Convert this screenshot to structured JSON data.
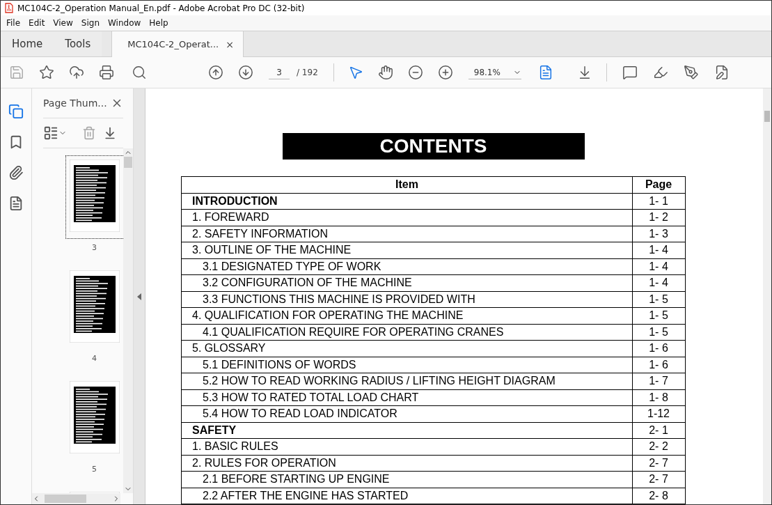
{
  "window": {
    "title": "MC104C-2_Operation Manual_En.pdf - Adobe Acrobat Pro DC (32-bit)"
  },
  "menu": [
    "File",
    "Edit",
    "View",
    "Sign",
    "Window",
    "Help"
  ],
  "tabs": [
    {
      "label": "Home",
      "selected": false,
      "kind": "nav"
    },
    {
      "label": "Tools",
      "selected": false,
      "kind": "nav"
    },
    {
      "label": "MC104C-2_Operat...",
      "selected": true,
      "kind": "document",
      "close": "×"
    }
  ],
  "toolbar": {
    "page_number": "3",
    "page_total": "/ 192",
    "zoom": "98.1%"
  },
  "sidebar": {
    "title": "Page Thum...",
    "thumbnails": [
      {
        "page": "3",
        "selected": true
      },
      {
        "page": "4",
        "selected": false
      },
      {
        "page": "5",
        "selected": false
      },
      {
        "selected": false
      }
    ]
  },
  "document": {
    "heading": "CONTENTS",
    "columns": [
      "Item",
      "Page"
    ],
    "rows": [
      {
        "item": "INTRODUCTION",
        "page": "1- 1",
        "kind": "part",
        "children": []
      },
      {
        "item": "1. FOREWARD",
        "page": "1- 2",
        "kind": "chapter",
        "children": []
      },
      {
        "item": "2. SAFETY INFORMATION",
        "page": "1- 3",
        "kind": "chapter",
        "children": []
      },
      {
        "item": "3. OUTLINE OF THE MACHINE",
        "page": "1- 4",
        "kind": "chapter",
        "children": [
          {
            "item": "3.1 DESIGNATED TYPE OF WORK",
            "page": "1- 4"
          },
          {
            "item": "3.2 CONFIGURATION OF THE MACHINE",
            "page": "1- 4"
          },
          {
            "item": "3.3 FUNCTIONS THIS MACHINE IS PROVIDED WITH",
            "page": "1- 5"
          }
        ]
      },
      {
        "item": "4. QUALIFICATION FOR OPERATING THE MACHINE",
        "page": "1- 5",
        "kind": "chapter",
        "children": [
          {
            "item": "4.1 QUALIFICATION REQUIRE FOR OPERATING CRANES",
            "page": "1- 5"
          }
        ]
      },
      {
        "item": "5. GLOSSARY",
        "page": "1- 6",
        "kind": "chapter",
        "children": [
          {
            "item": "5.1 DEFINITIONS OF WORDS",
            "page": "1- 6"
          },
          {
            "item": "5.2 HOW TO READ WORKING RADIUS / LIFTING HEIGHT DIAGRAM",
            "page": "1- 7"
          },
          {
            "item": "5.3 HOW TO RATED TOTAL LOAD CHART",
            "page": "1- 8"
          },
          {
            "item": "5.4 HOW TO READ LOAD INDICATOR",
            "page": "1-12"
          }
        ]
      },
      {
        "item": "SAFETY",
        "page": "2- 1",
        "kind": "part",
        "children": []
      },
      {
        "item": "1. BASIC RULES",
        "page": "2- 2",
        "kind": "chapter",
        "children": []
      },
      {
        "item": "2. RULES FOR OPERATION",
        "page": "2- 7",
        "kind": "chapter",
        "children": [
          {
            "item": "2.1 BEFORE STARTING UP ENGINE",
            "page": "2- 7"
          },
          {
            "item": "2.2 AFTER THE ENGINE HAS STARTED",
            "page": "2- 8"
          }
        ]
      }
    ]
  }
}
